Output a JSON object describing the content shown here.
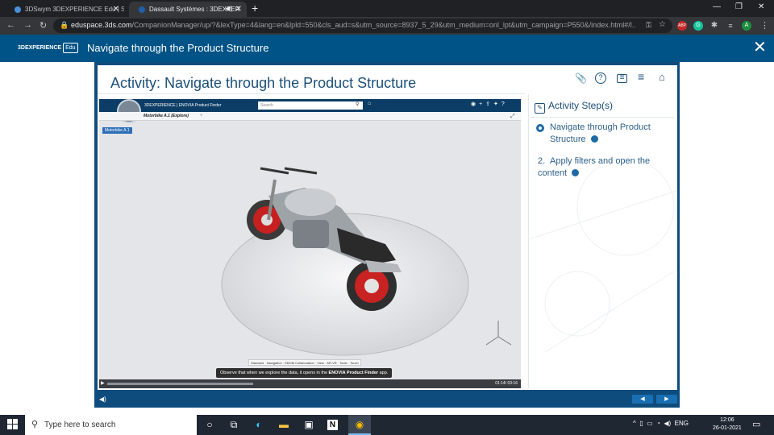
{
  "browser": {
    "tabs": [
      {
        "title": "3DSwym 3DEXPERIENCE Edu | St",
        "active": false
      },
      {
        "title": "Dassault Systèmes : 3DEXPER",
        "active": true
      }
    ],
    "url_host": "eduspace.3ds.com",
    "url_path": "/CompanionManager/up/?&lexType=4&lang=en&lpld=550&cls_aud=s&utm_source=8937_5_29&utm_medium=onl_lpt&utm_campaign=P550&/index.html#/l...",
    "profile_initial": "A",
    "extensions": [
      "ABP",
      "G"
    ]
  },
  "app": {
    "brand": "3DEXPERIENCE",
    "brand_suffix": "Edu",
    "title": "Navigate through the Product Structure"
  },
  "activity": {
    "title": "Activity: Navigate through the Product Structure",
    "steps_header": "Activity Step(s)",
    "steps": [
      {
        "number": "",
        "label": "Navigate through Product Structure",
        "current": true
      },
      {
        "number": "2.",
        "label": "Apply filters and open the content",
        "current": false
      }
    ]
  },
  "viewer": {
    "app_brand": "3DEXPERIENCE | ENOVIA Product Finder",
    "search_placeholder": "Search",
    "active_tab": "Motorbike A.1 (Explore)",
    "tree_root": "Motorbike A.1",
    "toolbar_tabs": [
      "Standard",
      "Navigation",
      "EBOM Collaboration",
      "View",
      "AR-VR",
      "Tools",
      "Touch"
    ],
    "caption_prefix": "Observe that when we explore the data, it opens in the ",
    "caption_app": "ENOVIA Product Finder",
    "caption_suffix": " app.",
    "time": "01:14/ 03:16",
    "progress": 0.39
  },
  "taskbar": {
    "search_placeholder": "Type here to search",
    "language": "ENG",
    "time": "12:06",
    "date": "26-01-2021"
  },
  "colors": {
    "header_blue": "#005386",
    "player_frame": "#0e4c7d",
    "title_text": "#1b4f7a",
    "step_accent": "#1e6aa5"
  }
}
